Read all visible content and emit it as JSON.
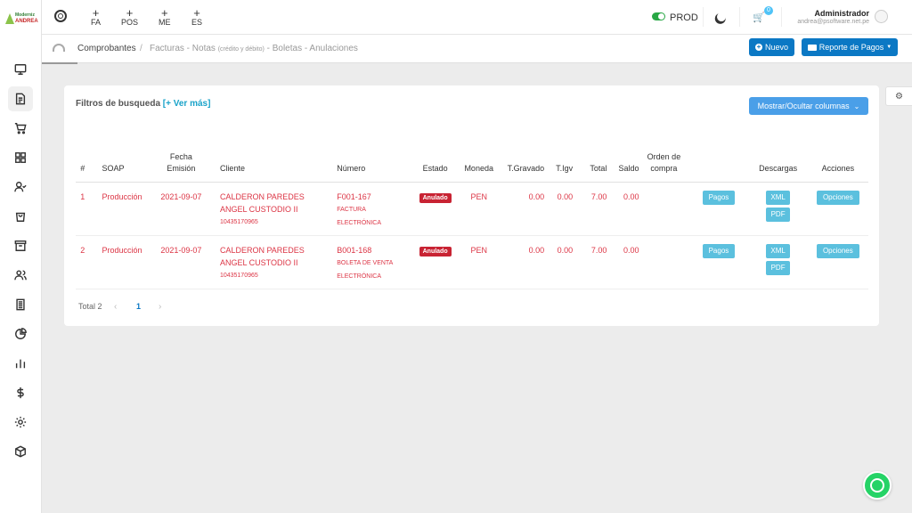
{
  "brand": {
    "line1": "Moderniz",
    "line2": "ANDREA"
  },
  "topbar": {
    "quick_links": [
      {
        "label": "FA"
      },
      {
        "label": "POS"
      },
      {
        "label": "ME"
      },
      {
        "label": "ES"
      }
    ],
    "env_label": "PROD",
    "cart_count": "0",
    "user_name": "Administrador",
    "user_email": "andrea@psoftware.net.pe"
  },
  "breadcrumb": {
    "root": "Comprobantes",
    "separator": "/",
    "current_prefix": "Facturas - Notas",
    "current_small": "(crédito y débito)",
    "current_suffix": "- Boletas - Anulaciones"
  },
  "actions": {
    "new_label": "Nuevo",
    "report_label": "Reporte de Pagos"
  },
  "filters": {
    "title": "Filtros de busqueda",
    "more": "[+ Ver más]",
    "columns_button": "Mostrar/Ocultar columnas"
  },
  "table": {
    "headers": {
      "idx": "#",
      "soap": "SOAP",
      "fecha_line1": "Fecha",
      "fecha_line2": "Emisión",
      "cliente": "Cliente",
      "numero": "Número",
      "estado": "Estado",
      "moneda": "Moneda",
      "gravado": "T.Gravado",
      "igv": "T.Igv",
      "total": "Total",
      "saldo": "Saldo",
      "orden_line1": "Orden de",
      "orden_line2": "compra",
      "descargas": "Descargas",
      "acciones": "Acciones"
    },
    "rows": [
      {
        "idx": "1",
        "soap": "Producción",
        "fecha": "2021-09-07",
        "cliente1": "CALDERON PAREDES",
        "cliente2": "ANGEL CUSTODIO II",
        "ruc": "10435170965",
        "numero": "F001-167",
        "tipo1": "FACTURA",
        "tipo2": "ELECTRÓNICA",
        "estado": "Anulado",
        "moneda": "PEN",
        "gravado": "0.00",
        "igv": "0.00",
        "total": "7.00",
        "saldo": "0.00",
        "pagos": "Pagos",
        "xml": "XML",
        "pdf": "PDF",
        "opciones": "Opciones"
      },
      {
        "idx": "2",
        "soap": "Producción",
        "fecha": "2021-09-07",
        "cliente1": "CALDERON PAREDES",
        "cliente2": "ANGEL CUSTODIO II",
        "ruc": "10435170965",
        "numero": "B001-168",
        "tipo1": "BOLETA DE VENTA",
        "tipo2": "ELECTRÓNICA",
        "estado": "Anulado",
        "moneda": "PEN",
        "gravado": "0.00",
        "igv": "0.00",
        "total": "7.00",
        "saldo": "0.00",
        "pagos": "Pagos",
        "xml": "XML",
        "pdf": "PDF",
        "opciones": "Opciones"
      }
    ]
  },
  "pagination": {
    "total_label": "Total 2",
    "prev": "‹",
    "page": "1",
    "next": "›"
  },
  "colors": {
    "primary": "#0b78c4",
    "danger": "#dc3545",
    "info": "#5bc0de",
    "success": "#28a745"
  }
}
